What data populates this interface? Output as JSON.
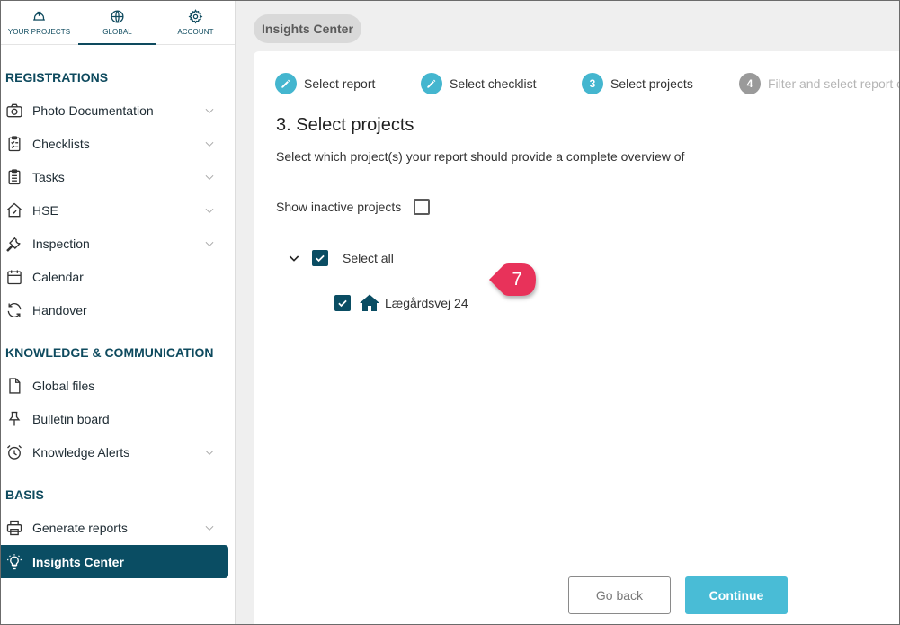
{
  "topnav": {
    "items": [
      {
        "label": "YOUR PROJECTS",
        "icon": "helmet-icon"
      },
      {
        "label": "GLOBAL",
        "icon": "globe-icon"
      },
      {
        "label": "ACCOUNT",
        "icon": "gear-icon"
      }
    ]
  },
  "sidebar": {
    "sections": {
      "registrations": "REGISTRATIONS",
      "knowledge": "KNOWLEDGE & COMMUNICATION",
      "basis": "BASIS"
    },
    "items": {
      "photo": "Photo Documentation",
      "checklists": "Checklists",
      "tasks": "Tasks",
      "hse": "HSE",
      "inspection": "Inspection",
      "calendar": "Calendar",
      "handover": "Handover",
      "global_files": "Global files",
      "bulletin": "Bulletin board",
      "alerts": "Knowledge Alerts",
      "generate": "Generate reports",
      "insights": "Insights Center"
    }
  },
  "main": {
    "chip": "Insights Center",
    "steps": [
      {
        "number": "",
        "label": "Select report",
        "state": "done"
      },
      {
        "number": "",
        "label": "Select checklist",
        "state": "done"
      },
      {
        "number": "3",
        "label": "Select projects",
        "state": "current"
      },
      {
        "number": "4",
        "label": "Filter and select report c",
        "state": "todo"
      }
    ],
    "heading": "3. Select projects",
    "description": "Select which project(s) your report should provide a complete overview of",
    "show_inactive": "Show inactive projects",
    "select_all": "Select all",
    "project": "Lægårdsvej 24",
    "badge": "7",
    "go_back": "Go back",
    "continue": "Continue"
  },
  "colors": {
    "brand_dark": "#0a4d63",
    "accent": "#44b6cf",
    "badge": "#e8305a"
  }
}
